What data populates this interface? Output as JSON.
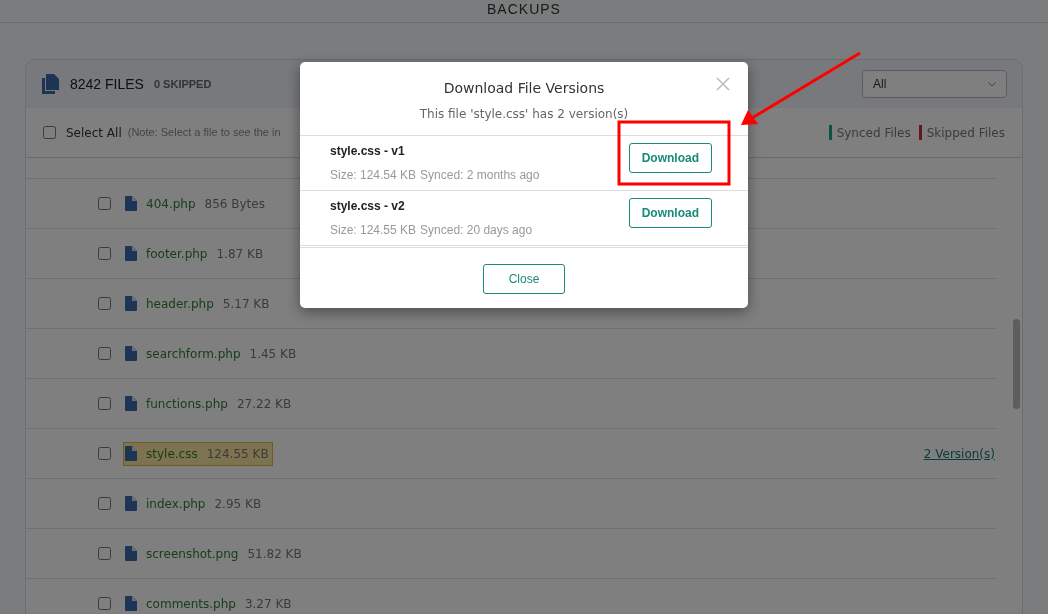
{
  "page": {
    "title": "BACKUPS"
  },
  "file_panel": {
    "file_count": "8242 FILES",
    "skipped_count": "0 SKIPPED",
    "filter": {
      "value": "All"
    },
    "select_all": {
      "label": "Select All",
      "checked": false
    },
    "note": "(Note: Select a file to see the in",
    "legend": [
      {
        "label": "Synced Files",
        "color": "#0f5044"
      },
      {
        "label": "Skipped Files",
        "color": "#64181d"
      }
    ],
    "files": [
      {
        "name": "404.php",
        "size": "856 Bytes",
        "checked": false,
        "highlighted": false
      },
      {
        "name": "footer.php",
        "size": "1.87 KB",
        "checked": false,
        "highlighted": false
      },
      {
        "name": "header.php",
        "size": "5.17 KB",
        "checked": false,
        "highlighted": false
      },
      {
        "name": "searchform.php",
        "size": "1.45 KB",
        "checked": false,
        "highlighted": false
      },
      {
        "name": "functions.php",
        "size": "27.22 KB",
        "checked": false,
        "highlighted": false
      },
      {
        "name": "style.css",
        "size": "124.55 KB",
        "checked": false,
        "highlighted": true,
        "versions_link": "2 Version(s)"
      },
      {
        "name": "index.php",
        "size": "2.95 KB",
        "checked": false,
        "highlighted": false
      },
      {
        "name": "screenshot.png",
        "size": "51.82 KB",
        "checked": false,
        "highlighted": false
      },
      {
        "name": "comments.php",
        "size": "3.27 KB",
        "checked": false,
        "highlighted": false
      }
    ]
  },
  "dialog": {
    "title": "Download File Versions",
    "subtitle": "This file 'style.css' has 2 version(s)",
    "versions": [
      {
        "name": "style.css - v1",
        "size": "Size: 124.54 KB",
        "synced": "Synced: 2 months ago",
        "button": "Download"
      },
      {
        "name": "style.css - v2",
        "size": "Size: 124.55 KB",
        "synced": "Synced: 20 days ago",
        "button": "Download"
      }
    ],
    "close_button": "Close"
  }
}
